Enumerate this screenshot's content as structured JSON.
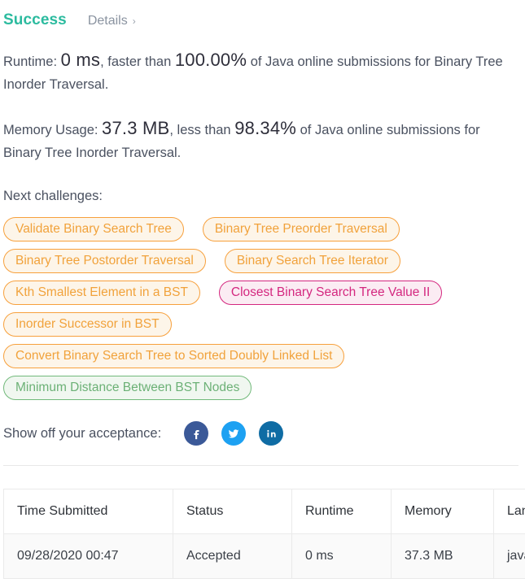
{
  "header": {
    "status_title": "Success",
    "details_label": "Details",
    "chevron": "›"
  },
  "stats": {
    "runtime": {
      "prefix": "Runtime:",
      "value": "0 ms",
      "middle": ", faster than",
      "percent": "100.00%",
      "suffix": "of Java online submissions for Binary Tree Inorder Traversal."
    },
    "memory": {
      "prefix": "Memory Usage:",
      "value": "37.3 MB",
      "middle": ", less than",
      "percent": "98.34%",
      "suffix": "of Java online submissions for Binary Tree Inorder Traversal."
    }
  },
  "next_challenges": {
    "label": "Next challenges:",
    "rows": [
      [
        {
          "label": "Validate Binary Search Tree",
          "difficulty": "medium"
        },
        {
          "label": "Binary Tree Preorder Traversal",
          "difficulty": "medium"
        }
      ],
      [
        {
          "label": "Binary Tree Postorder Traversal",
          "difficulty": "medium"
        },
        {
          "label": "Binary Search Tree Iterator",
          "difficulty": "medium"
        }
      ],
      [
        {
          "label": "Kth Smallest Element in a BST",
          "difficulty": "medium"
        },
        {
          "label": "Closest Binary Search Tree Value II",
          "difficulty": "hard"
        }
      ],
      [
        {
          "label": "Inorder Successor in BST",
          "difficulty": "medium"
        }
      ],
      [
        {
          "label": "Convert Binary Search Tree to Sorted Doubly Linked List",
          "difficulty": "medium"
        }
      ],
      [
        {
          "label": "Minimum Distance Between BST Nodes",
          "difficulty": "easy"
        }
      ]
    ]
  },
  "share": {
    "label": "Show off your acceptance:",
    "networks": [
      {
        "name": "facebook",
        "icon": "facebook-icon"
      },
      {
        "name": "twitter",
        "icon": "twitter-icon"
      },
      {
        "name": "linkedin",
        "icon": "linkedin-icon"
      }
    ]
  },
  "submissions_table": {
    "columns": [
      "Time Submitted",
      "Status",
      "Runtime",
      "Memory",
      "Language"
    ],
    "rows": [
      {
        "time_submitted": "09/28/2020 00:47",
        "status": "Accepted",
        "runtime": "0 ms",
        "memory": "37.3 MB",
        "language": "java"
      }
    ]
  },
  "colors": {
    "success_green": "#2cbb9f",
    "medium_orange": "#f1a23b",
    "hard_pink": "#d4277f",
    "easy_green": "#6cb176",
    "facebook_blue": "#3b5998",
    "twitter_blue": "#1da1f2",
    "linkedin_blue": "#0f6ca4"
  }
}
